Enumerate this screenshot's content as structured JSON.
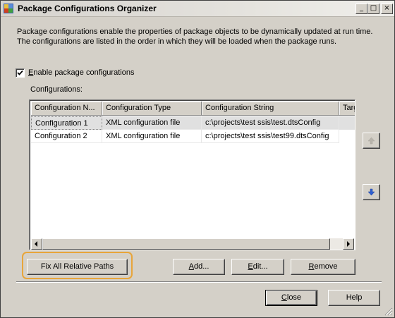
{
  "window": {
    "title": "Package Configurations Organizer",
    "minimize_glyph": "_",
    "maximize_glyph": "□",
    "close_glyph": "×"
  },
  "description": {
    "line1": "Package configurations enable the properties of package objects to be dynamically updated at run time.",
    "line2": "The configurations are listed in the order in which they will be loaded when the package runs."
  },
  "enable_checkbox": {
    "label_prefix": "",
    "label_mnemonic": "E",
    "label_rest": "nable package configurations",
    "checked": true
  },
  "configurations_label": "Configurations:",
  "list": {
    "columns": [
      "Configuration N...",
      "Configuration Type",
      "Configuration String",
      "Targ"
    ],
    "rows": [
      {
        "name": "Configuration 1",
        "type": "XML configuration file",
        "string": "c:\\projects\\test ssis\\test.dtsConfig",
        "selected": true
      },
      {
        "name": "Configuration 2",
        "type": "XML configuration file",
        "string": "c:\\projects\\test ssis\\test99.dtsConfig",
        "selected": false
      }
    ]
  },
  "buttons": {
    "fix_paths": "Fix All Relative Paths",
    "add_mnemonic": "A",
    "add_rest": "dd...",
    "edit_mnemonic": "E",
    "edit_rest": "dit...",
    "remove_mnemonic": "R",
    "remove_rest": "emove",
    "close_mnemonic": "C",
    "close_rest": "lose",
    "help": "Help"
  },
  "colors": {
    "highlight_border": "#e8a53a",
    "arrow_blue": "#2f5fd0"
  }
}
